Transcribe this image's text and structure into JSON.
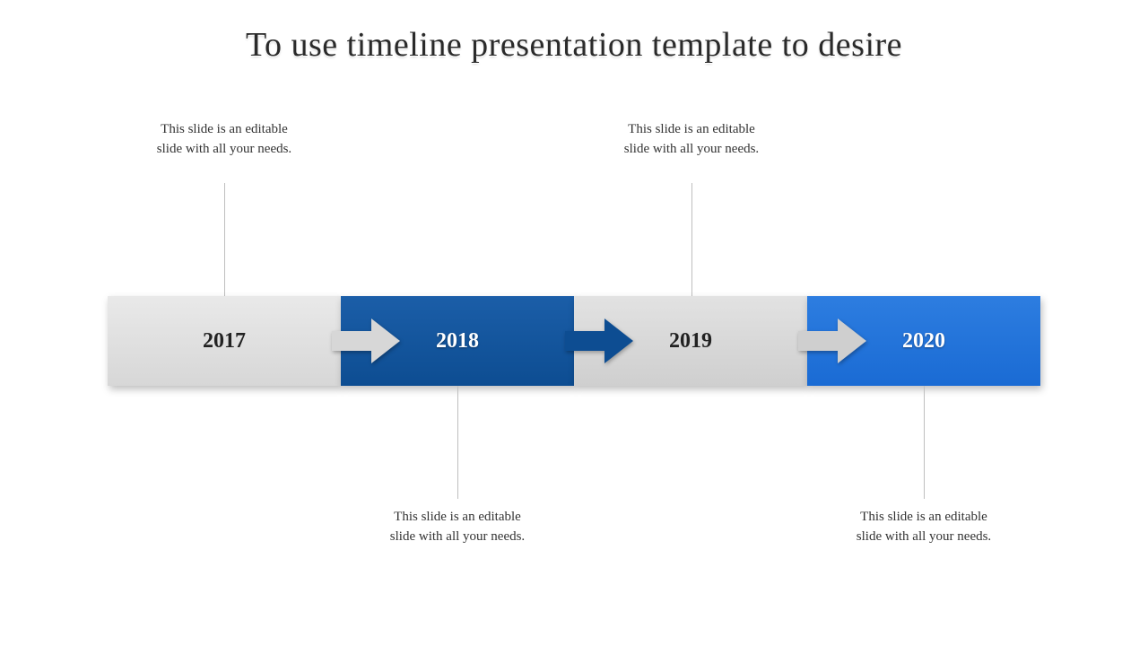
{
  "title": "To use timeline presentation template to desire",
  "timeline": {
    "items": [
      {
        "year": "2017",
        "caption": "This slide is an editable slide with all your needs.",
        "position": "top"
      },
      {
        "year": "2018",
        "caption": "This slide is an editable slide with all your needs.",
        "position": "bottom"
      },
      {
        "year": "2019",
        "caption": "This slide is an editable slide with all your needs.",
        "position": "top"
      },
      {
        "year": "2020",
        "caption": "This slide is an editable slide with all your needs.",
        "position": "bottom"
      }
    ]
  },
  "colors": {
    "gray": "#d7d7d7",
    "blue_dark": "#0d4d92",
    "blue_light": "#1a6bd4"
  }
}
